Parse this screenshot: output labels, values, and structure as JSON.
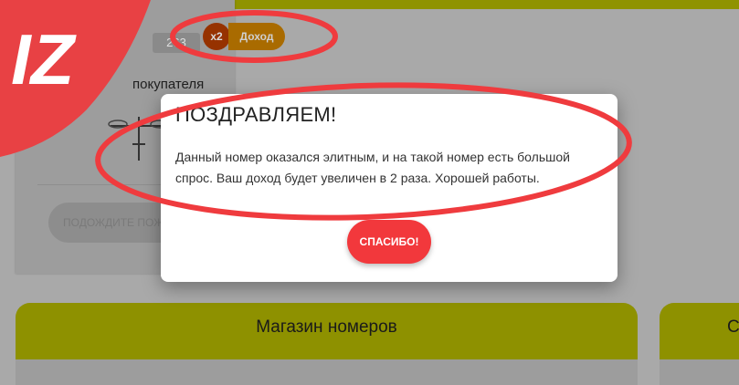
{
  "colors": {
    "accent_red": "#f2383c",
    "header_olive": "#8e9100",
    "overlay_gray": "#a9a9a9",
    "highlight_red": "#ef3b3e"
  },
  "logo": {
    "text": "IZ"
  },
  "card": {
    "price": "263",
    "title": "покупателя",
    "wait_button": "ПОДОЖДИТЕ ПОЖАЛ"
  },
  "badges": {
    "multiplier": "x2",
    "income": "Доход"
  },
  "modal": {
    "title": "ПОЗДРАВЛЯЕМ!",
    "body": "Данный номер оказался элитным, и на такой номер есть большой спрос. Ваш доход будет увеличен в 2 раза. Хорошей работы.",
    "button": "СПАСИБО!"
  },
  "shop": {
    "title": "Магазин номеров",
    "second_title": "С"
  }
}
